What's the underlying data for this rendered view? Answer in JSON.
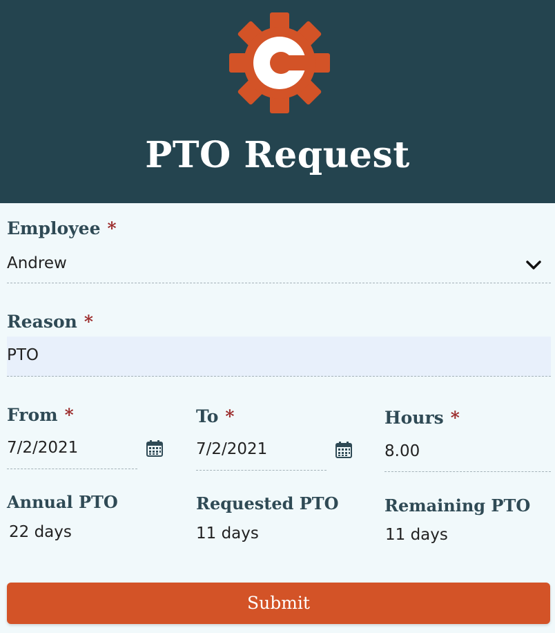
{
  "header": {
    "title": "PTO Request",
    "logo_icon": "gear-c-logo",
    "background_color": "#24444f",
    "logo_color": "#d35327"
  },
  "form": {
    "required_marker": "*",
    "employee": {
      "label": "Employee",
      "value": "Andrew",
      "icon": "chevron-down-icon"
    },
    "reason": {
      "label": "Reason",
      "value": "PTO"
    },
    "from": {
      "label": "From",
      "value": "7/2/2021",
      "icon": "calendar-icon"
    },
    "to": {
      "label": "To",
      "value": "7/2/2021",
      "icon": "calendar-icon"
    },
    "hours": {
      "label": "Hours",
      "value": "8.00"
    }
  },
  "summary": {
    "annual": {
      "label": "Annual PTO",
      "value": "22 days"
    },
    "requested": {
      "label": "Requested PTO",
      "value": "11 days"
    },
    "remaining": {
      "label": "Remaining PTO",
      "value": "11 days"
    }
  },
  "actions": {
    "submit_label": "Submit",
    "submit_color": "#d35327"
  }
}
